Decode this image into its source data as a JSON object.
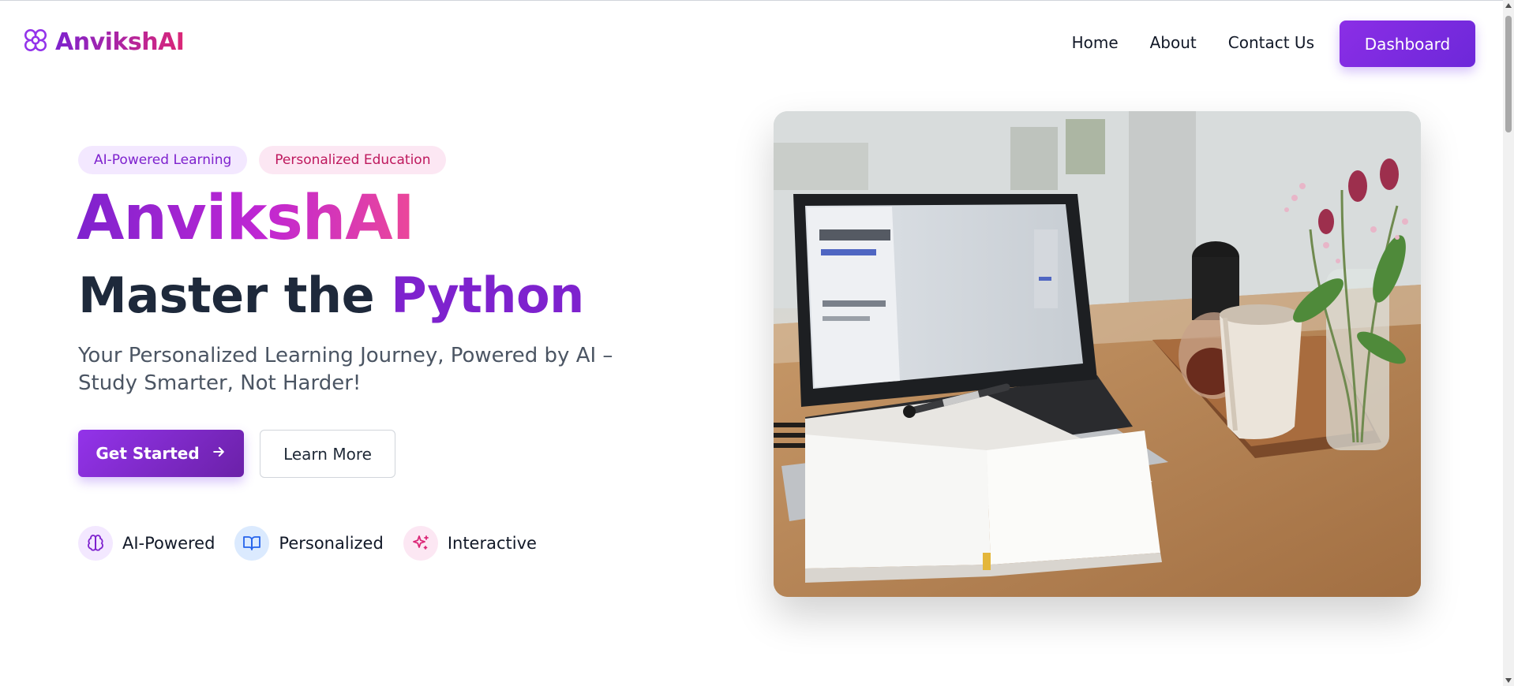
{
  "brand": {
    "name": "AnvikshAI"
  },
  "nav": {
    "links": [
      "Home",
      "About",
      "Contact Us"
    ],
    "dashboard_label": "Dashboard"
  },
  "hero": {
    "tags": [
      "AI-Powered Learning",
      "Personalized Education"
    ],
    "title": "AnvikshAI",
    "subtitle_prefix": "Master the ",
    "subtitle_accent": "Python",
    "description": "Your Personalized Learning Journey, Powered by AI – Study Smarter, Not Harder!",
    "primary_cta": "Get Started",
    "secondary_cta": "Learn More",
    "features": [
      {
        "label": "AI-Powered",
        "icon": "brain-icon"
      },
      {
        "label": "Personalized",
        "icon": "book-open-icon"
      },
      {
        "label": "Interactive",
        "icon": "sparkles-icon"
      }
    ],
    "image_alt": "laptop-notebook-coffee-desk-photo"
  },
  "colors": {
    "brand_purple": "#7e22ce",
    "brand_pink": "#db2777",
    "button_gradient_start": "#9333ea",
    "button_gradient_end": "#6b21a8"
  }
}
